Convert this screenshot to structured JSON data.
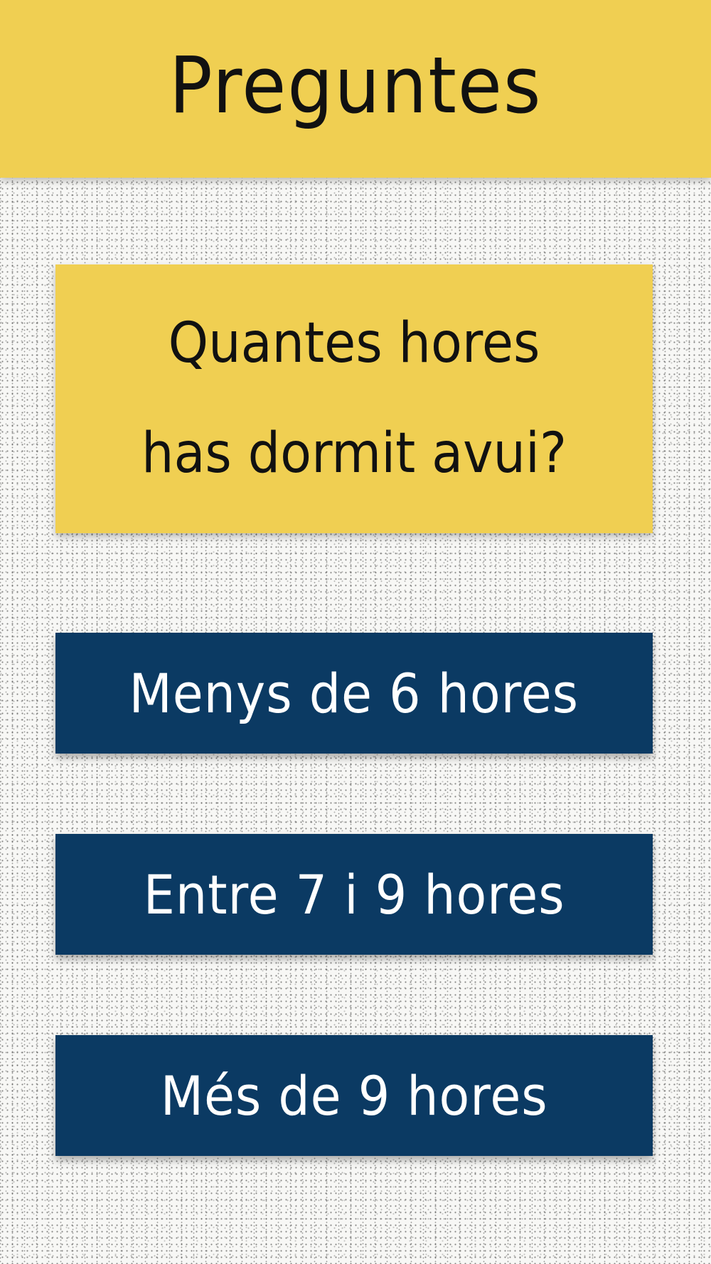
{
  "header": {
    "title": "Preguntes"
  },
  "question": {
    "text": "Quantes hores has dormit avui?"
  },
  "answers": [
    {
      "label": "Menys de 6 hores"
    },
    {
      "label": "Entre 7 i 9 hores"
    },
    {
      "label": "Més de 9 hores"
    }
  ],
  "colors": {
    "accent_yellow": "#f0cf52",
    "button_navy": "#0b3a63",
    "button_text": "#ffffff",
    "text_dark": "#111111"
  }
}
